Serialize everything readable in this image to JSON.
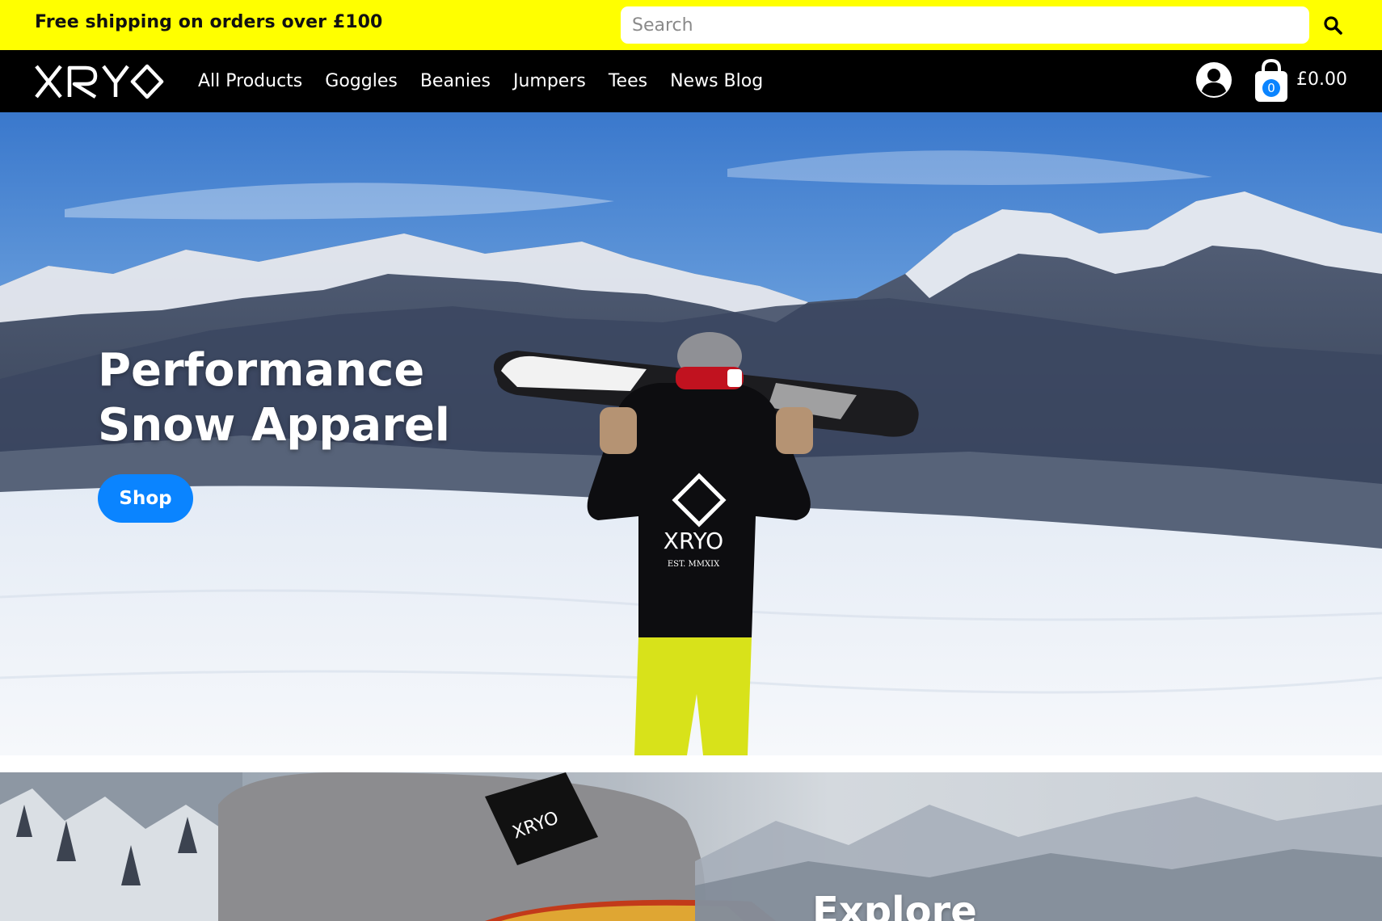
{
  "promo": {
    "text": "Free shipping on orders over £100"
  },
  "search": {
    "placeholder": "Search"
  },
  "brand": {
    "logo_text": "XRYO"
  },
  "nav": {
    "items": [
      {
        "label": "All Products"
      },
      {
        "label": "Goggles"
      },
      {
        "label": "Beanies"
      },
      {
        "label": "Jumpers"
      },
      {
        "label": "Tees"
      },
      {
        "label": "News Blog"
      }
    ]
  },
  "cart": {
    "count": "0",
    "total": "£0.00"
  },
  "hero": {
    "title_line1": "Performance",
    "title_line2": "Snow Apparel",
    "button_label": "Shop",
    "hoodie_logo": "XRYO",
    "hoodie_tagline": "EST. MMXIX"
  },
  "banner2": {
    "title": "Explore",
    "beanie_tag_text": "XRYO"
  },
  "colors": {
    "promo_bg": "#ffff00",
    "header_bg": "#000000",
    "accent_blue": "#0a84ff",
    "white": "#ffffff"
  },
  "icons": {
    "search": "search-icon",
    "account": "user-circle-icon",
    "cart": "shopping-bag-icon"
  }
}
